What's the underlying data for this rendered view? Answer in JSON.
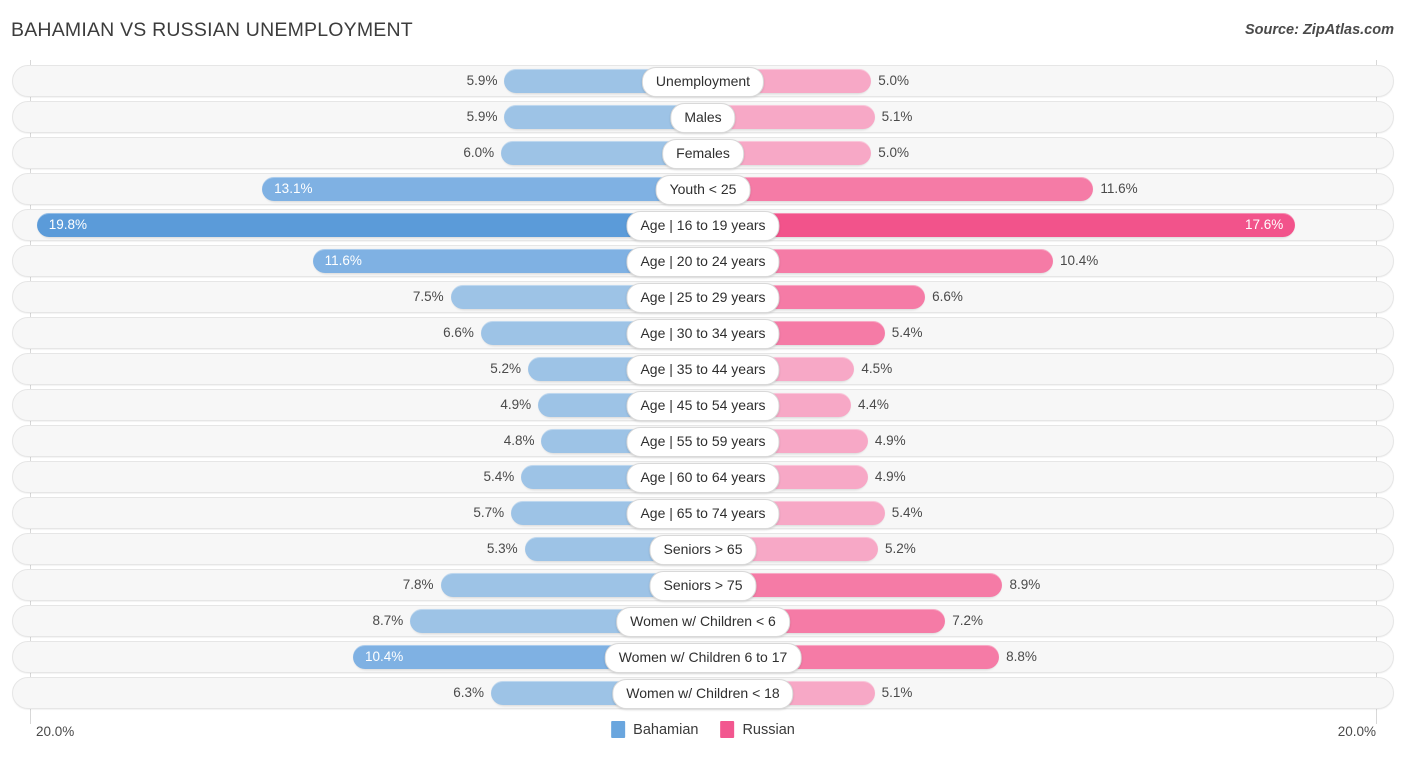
{
  "header": {
    "title": "BAHAMIAN VS RUSSIAN UNEMPLOYMENT",
    "source": "Source: ZipAtlas.com"
  },
  "axis": {
    "left_label": "20.0%",
    "right_label": "20.0%",
    "max": 20.0
  },
  "legend": [
    {
      "label": "Bahamian",
      "color": "#6aa6de"
    },
    {
      "label": "Russian",
      "color": "#f2578f"
    }
  ],
  "colors": {
    "left_high": "#5b9bd9",
    "left_mid": "#7fb1e3",
    "left_low": "#9dc3e6",
    "right_high": "#f2538b",
    "right_mid": "#f57ba6",
    "right_low": "#f7a8c6",
    "track_bg": "#f7f7f7",
    "track_border": "#e6e6e6",
    "gridline": "#d8d8d8"
  },
  "chart_data": {
    "type": "bar",
    "subtype": "diverging-butterfly",
    "title": "BAHAMIAN VS RUSSIAN UNEMPLOYMENT",
    "xlabel": "",
    "ylabel": "",
    "xlim": [
      20.0,
      20.0
    ],
    "grid": true,
    "legend_position": "bottom-center",
    "categories": [
      "Unemployment",
      "Males",
      "Females",
      "Youth < 25",
      "Age | 16 to 19 years",
      "Age | 20 to 24 years",
      "Age | 25 to 29 years",
      "Age | 30 to 34 years",
      "Age | 35 to 44 years",
      "Age | 45 to 54 years",
      "Age | 55 to 59 years",
      "Age | 60 to 64 years",
      "Age | 65 to 74 years",
      "Seniors > 65",
      "Seniors > 75",
      "Women w/ Children < 6",
      "Women w/ Children 6 to 17",
      "Women w/ Children < 18"
    ],
    "series": [
      {
        "name": "Bahamian",
        "values": [
          5.9,
          5.9,
          6.0,
          13.1,
          19.8,
          11.6,
          7.5,
          6.6,
          5.2,
          4.9,
          4.8,
          5.4,
          5.7,
          5.3,
          7.8,
          8.7,
          10.4,
          6.3
        ]
      },
      {
        "name": "Russian",
        "values": [
          5.0,
          5.1,
          5.0,
          11.6,
          17.6,
          10.4,
          6.6,
          5.4,
          4.5,
          4.4,
          4.9,
          4.9,
          5.4,
          5.2,
          8.9,
          7.2,
          8.8,
          5.1
        ]
      }
    ]
  },
  "rows": [
    {
      "label": "Unemployment",
      "left": "5.9%",
      "right": "5.0%",
      "left_tier": "low",
      "right_tier": "low"
    },
    {
      "label": "Males",
      "left": "5.9%",
      "right": "5.1%",
      "left_tier": "low",
      "right_tier": "low"
    },
    {
      "label": "Females",
      "left": "6.0%",
      "right": "5.0%",
      "left_tier": "low",
      "right_tier": "low"
    },
    {
      "label": "Youth < 25",
      "left": "13.1%",
      "right": "11.6%",
      "left_tier": "mid",
      "right_tier": "mid"
    },
    {
      "label": "Age | 16 to 19 years",
      "left": "19.8%",
      "right": "17.6%",
      "left_tier": "high",
      "right_tier": "high"
    },
    {
      "label": "Age | 20 to 24 years",
      "left": "11.6%",
      "right": "10.4%",
      "left_tier": "mid",
      "right_tier": "mid"
    },
    {
      "label": "Age | 25 to 29 years",
      "left": "7.5%",
      "right": "6.6%",
      "left_tier": "low",
      "right_tier": "mid"
    },
    {
      "label": "Age | 30 to 34 years",
      "left": "6.6%",
      "right": "5.4%",
      "left_tier": "low",
      "right_tier": "mid"
    },
    {
      "label": "Age | 35 to 44 years",
      "left": "5.2%",
      "right": "4.5%",
      "left_tier": "low",
      "right_tier": "low"
    },
    {
      "label": "Age | 45 to 54 years",
      "left": "4.9%",
      "right": "4.4%",
      "left_tier": "low",
      "right_tier": "low"
    },
    {
      "label": "Age | 55 to 59 years",
      "left": "4.8%",
      "right": "4.9%",
      "left_tier": "low",
      "right_tier": "low"
    },
    {
      "label": "Age | 60 to 64 years",
      "left": "5.4%",
      "right": "4.9%",
      "left_tier": "low",
      "right_tier": "low"
    },
    {
      "label": "Age | 65 to 74 years",
      "left": "5.7%",
      "right": "5.4%",
      "left_tier": "low",
      "right_tier": "low"
    },
    {
      "label": "Seniors > 65",
      "left": "5.3%",
      "right": "5.2%",
      "left_tier": "low",
      "right_tier": "low"
    },
    {
      "label": "Seniors > 75",
      "left": "7.8%",
      "right": "8.9%",
      "left_tier": "low",
      "right_tier": "mid"
    },
    {
      "label": "Women w/ Children < 6",
      "left": "8.7%",
      "right": "7.2%",
      "left_tier": "low",
      "right_tier": "mid"
    },
    {
      "label": "Women w/ Children 6 to 17",
      "left": "10.4%",
      "right": "8.8%",
      "left_tier": "mid",
      "right_tier": "mid"
    },
    {
      "label": "Women w/ Children < 18",
      "left": "6.3%",
      "right": "5.1%",
      "left_tier": "low",
      "right_tier": "low"
    }
  ]
}
